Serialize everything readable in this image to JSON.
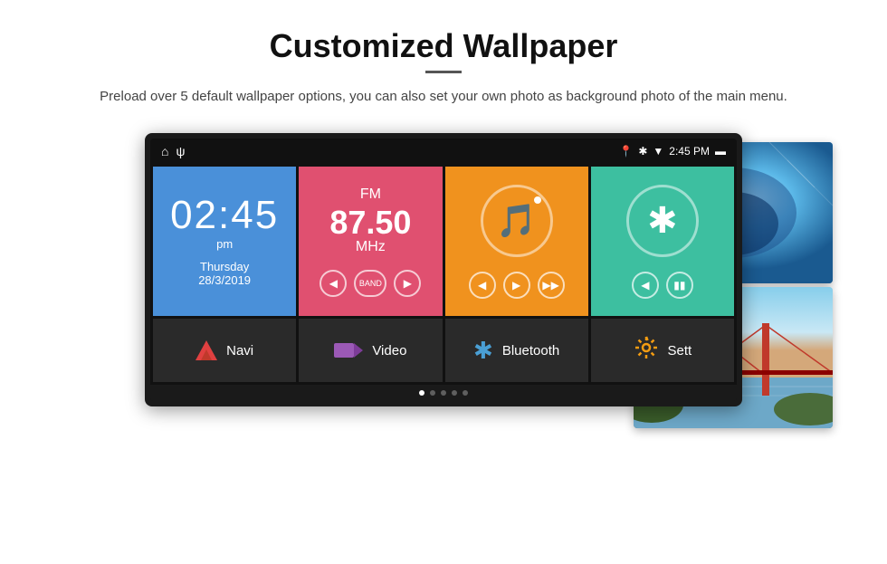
{
  "header": {
    "title": "Customized Wallpaper",
    "subtitle": "Preload over 5 default wallpaper options, you can also set your own photo as background photo of the main menu."
  },
  "statusBar": {
    "time": "2:45 PM",
    "icons": [
      "home",
      "usb",
      "location",
      "bluetooth",
      "wifi",
      "battery"
    ]
  },
  "tiles": {
    "clock": {
      "time": "02:45",
      "ampm": "pm",
      "day": "Thursday",
      "date": "28/3/2019"
    },
    "radio": {
      "band": "FM",
      "frequency": "87.50",
      "unit": "MHz"
    }
  },
  "navBar": {
    "items": [
      {
        "label": "Navi",
        "icon": "navigation-icon"
      },
      {
        "label": "Video",
        "icon": "video-icon"
      },
      {
        "label": "Bluetooth",
        "icon": "bluetooth-icon"
      },
      {
        "label": "Sett",
        "icon": "settings-icon"
      }
    ]
  },
  "dots": {
    "count": 5,
    "active": 0
  }
}
